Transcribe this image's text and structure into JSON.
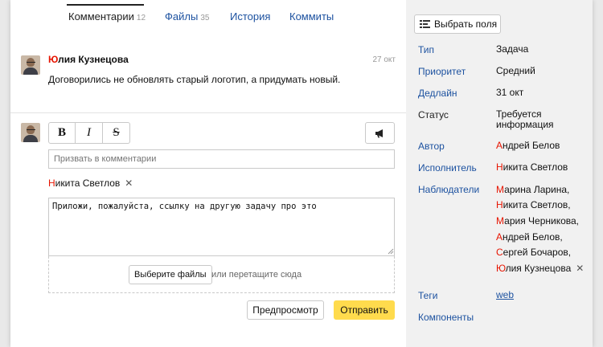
{
  "tabs": [
    {
      "label": "Комментарии",
      "count": "12",
      "active": true
    },
    {
      "label": "Файлы",
      "count": "35",
      "active": false
    },
    {
      "label": "История",
      "count": "",
      "active": false
    },
    {
      "label": "Коммиты",
      "count": "",
      "active": false
    }
  ],
  "comment": {
    "author_first": "Ю",
    "author_rest": "лия Кузнецова",
    "date": "27 окт",
    "text": "Договорились не обновлять старый логотип, а придумать новый."
  },
  "editor": {
    "bold_label": "B",
    "italic_label": "I",
    "strike_label": "S",
    "mention_placeholder": "Призвать в комментарии",
    "mentioned_first": "Н",
    "mentioned_rest": "икита Светлов",
    "remove_icon": "close-icon",
    "text": "Приложи, пожалуйста, ссылку на другую задачу про это",
    "choose_files_label": "Выберите файлы",
    "drop_hint": "или перетащите сюда",
    "preview_label": "Предпросмотр",
    "send_label": "Отправить",
    "send_color": "#ffdb4d"
  },
  "sidebar": {
    "choose_fields_label": "Выбрать поля",
    "props": {
      "type_label": "Тип",
      "type_value": "Задача",
      "priority_label": "Приоритет",
      "priority_value": "Средний",
      "deadline_label": "Дедлайн",
      "deadline_value": "31 окт",
      "status_label": "Статус",
      "status_value_1": "Требуется",
      "status_value_2": "информация",
      "author_label": "Автор",
      "author_first": "А",
      "author_rest": "ндрей Белов",
      "assignee_label": "Исполнитель",
      "assignee_first": "Н",
      "assignee_rest": "икита Светлов",
      "watchers_label": "Наблюдатели",
      "tags_label": "Теги",
      "tags_value": "web",
      "components_label": "Компоненты"
    },
    "watchers": [
      {
        "first": "М",
        "rest": "арина Ларина,"
      },
      {
        "first": "Н",
        "rest": "икита Светлов,"
      },
      {
        "first": "М",
        "rest": "ария Черникова,"
      },
      {
        "first": "А",
        "rest": "ндрей Белов,"
      },
      {
        "first": "С",
        "rest": "ергей Бочаров,"
      },
      {
        "first": "Ю",
        "rest": "лия Кузнецова"
      }
    ]
  },
  "colors": {
    "link": "#1d52a0",
    "accent_red": "#e61400",
    "sidebar_bg": "#f1f1f1"
  }
}
